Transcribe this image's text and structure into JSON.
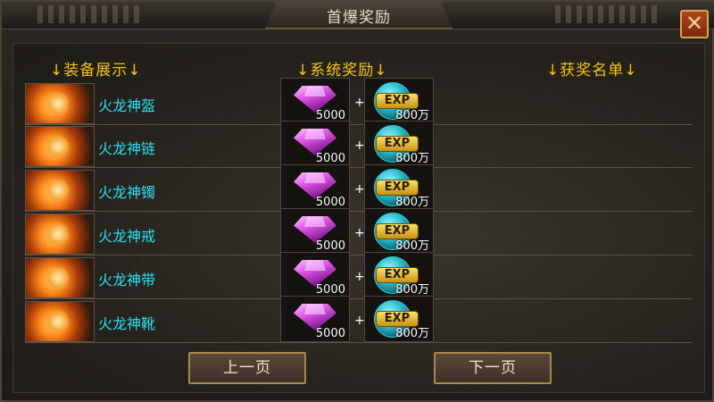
{
  "window": {
    "title": "首爆奖励",
    "close_symbol": "✕"
  },
  "headers": {
    "equipment": "↓装备展示↓",
    "reward": "↓系统奖励↓",
    "winners": "↓获奖名单↓"
  },
  "rows": [
    {
      "name": "火龙神盔",
      "gem_qty": "5000",
      "exp_qty": "800万",
      "plus": "+"
    },
    {
      "name": "火龙神链",
      "gem_qty": "5000",
      "exp_qty": "800万",
      "plus": "+"
    },
    {
      "name": "火龙神镯",
      "gem_qty": "5000",
      "exp_qty": "800万",
      "plus": "+"
    },
    {
      "name": "火龙神戒",
      "gem_qty": "5000",
      "exp_qty": "800万",
      "plus": "+"
    },
    {
      "name": "火龙神带",
      "gem_qty": "5000",
      "exp_qty": "800万",
      "plus": "+"
    },
    {
      "name": "火龙神靴",
      "gem_qty": "5000",
      "exp_qty": "800万",
      "plus": "+"
    }
  ],
  "icons": {
    "gem": "purple-gem-icon",
    "exp": "exp-orb-icon",
    "equipment": "flame-equipment-icon"
  },
  "exp_label": "EXP",
  "buttons": {
    "prev": "上一页",
    "next": "下一页"
  },
  "colors": {
    "header": "#f5c518",
    "item_name": "#2fe0f0",
    "close_bg": "#b0451e"
  }
}
